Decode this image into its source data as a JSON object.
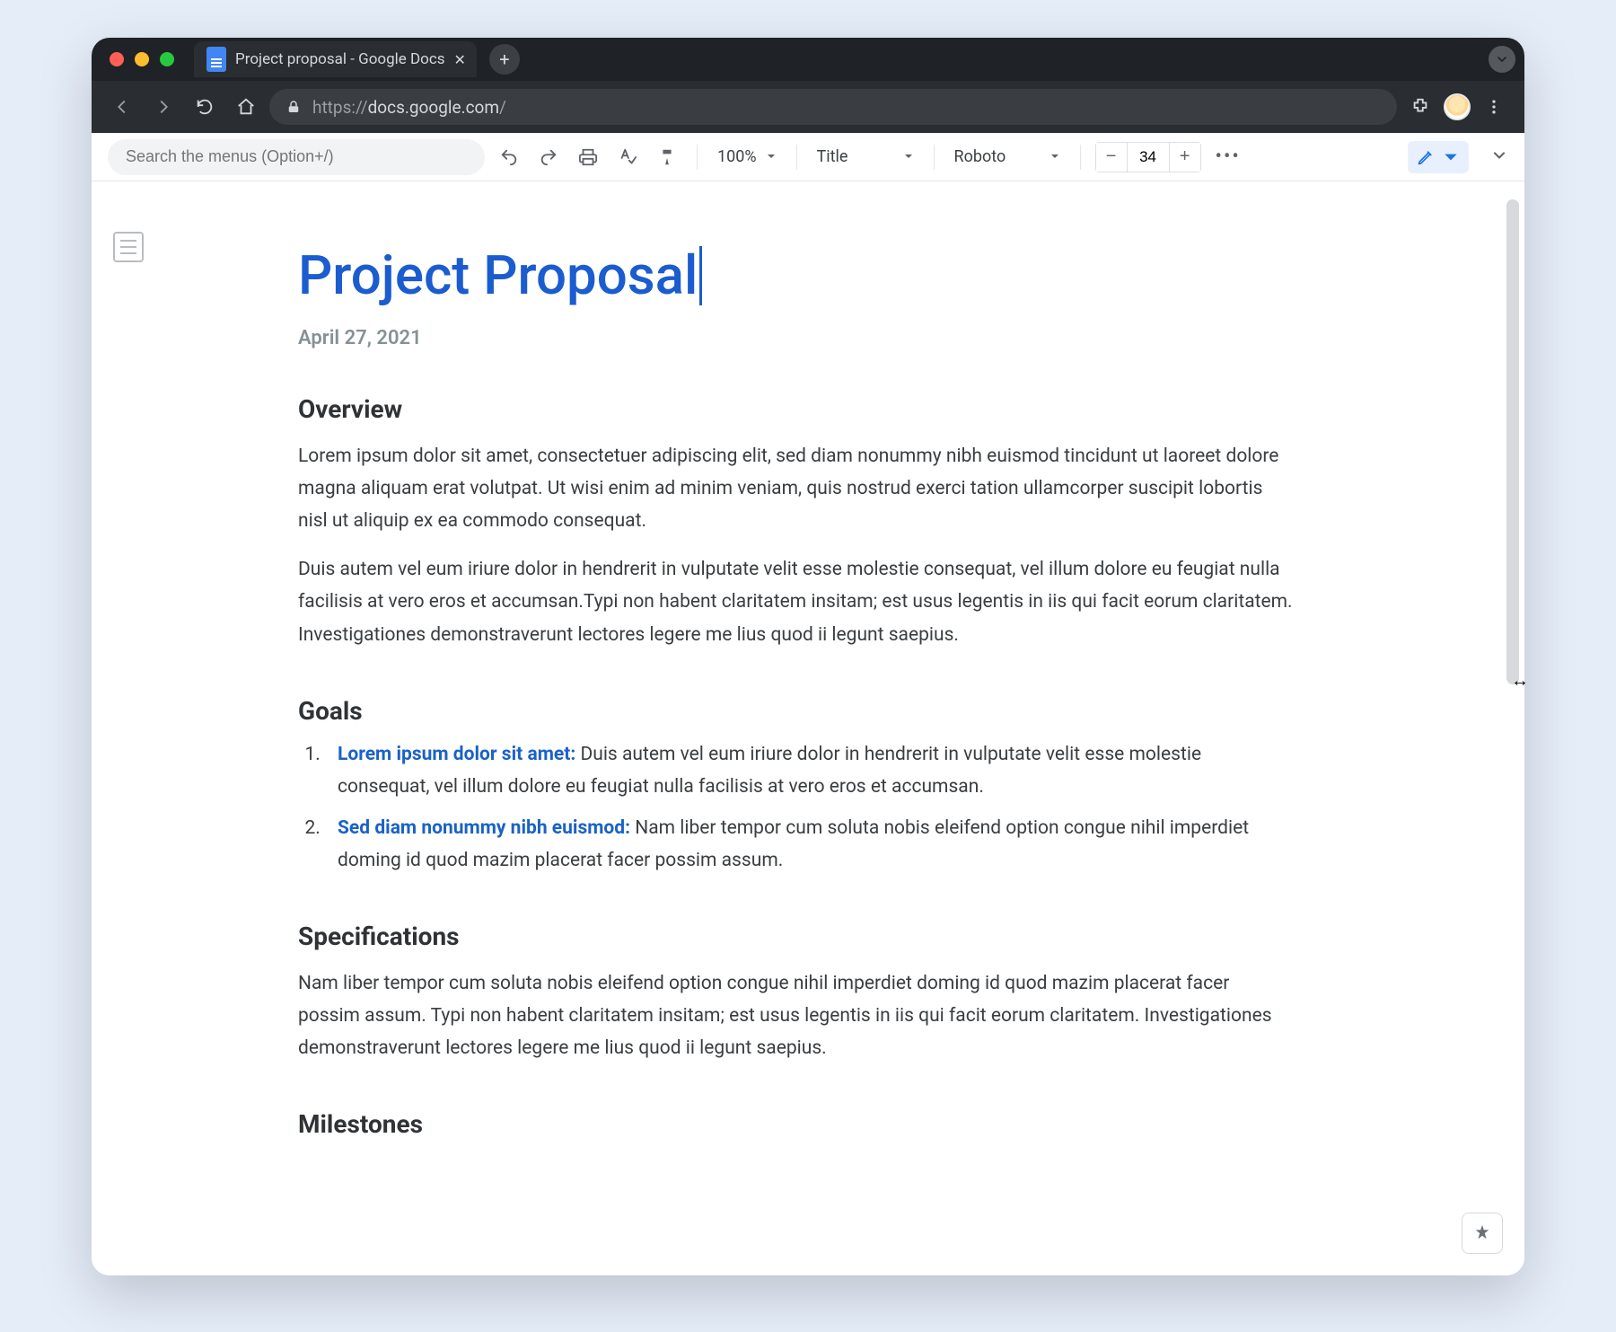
{
  "browser": {
    "tab_title": "Project proposal - Google Docs",
    "url_scheme": "https://",
    "url_host": "docs.google.com",
    "url_path": "/"
  },
  "toolbar": {
    "search_placeholder": "Search the menus (Option+/)",
    "zoom": "100%",
    "style": "Title",
    "font": "Roboto",
    "font_size": "34"
  },
  "doc": {
    "title": "Project Proposal",
    "date": "April 27, 2021",
    "overview_h": "Overview",
    "overview_p1": "Lorem ipsum dolor sit amet, consectetuer adipiscing elit, sed diam nonummy nibh euismod tincidunt ut laoreet dolore magna aliquam erat volutpat. Ut wisi enim ad minim veniam, quis nostrud exerci tation ullamcorper suscipit lobortis nisl ut aliquip ex ea commodo consequat.",
    "overview_p2": "Duis autem vel eum iriure dolor in hendrerit in vulputate velit esse molestie consequat, vel illum dolore eu feugiat nulla facilisis at vero eros et accumsan.Typi non habent claritatem insitam; est usus legentis in iis qui facit eorum claritatem. Investigationes demonstraverunt lectores legere me lius quod ii legunt saepius.",
    "goals_h": "Goals",
    "goals": [
      {
        "lead": "Lorem ipsum dolor sit amet:",
        "body": " Duis autem vel eum iriure dolor in hendrerit in vulputate velit esse molestie consequat, vel illum dolore eu feugiat nulla facilisis at vero eros et accumsan."
      },
      {
        "lead": "Sed diam nonummy nibh euismod:",
        "body": " Nam liber tempor cum soluta nobis eleifend option congue nihil imperdiet doming id quod mazim placerat facer possim assum."
      }
    ],
    "spec_h": "Specifications",
    "spec_p": "Nam liber tempor cum soluta nobis eleifend option congue nihil imperdiet doming id quod mazim placerat facer possim assum. Typi non habent claritatem insitam; est usus legentis in iis qui facit eorum claritatem. Investigationes demonstraverunt lectores legere me lius quod ii legunt saepius.",
    "milestones_h": "Milestones"
  }
}
